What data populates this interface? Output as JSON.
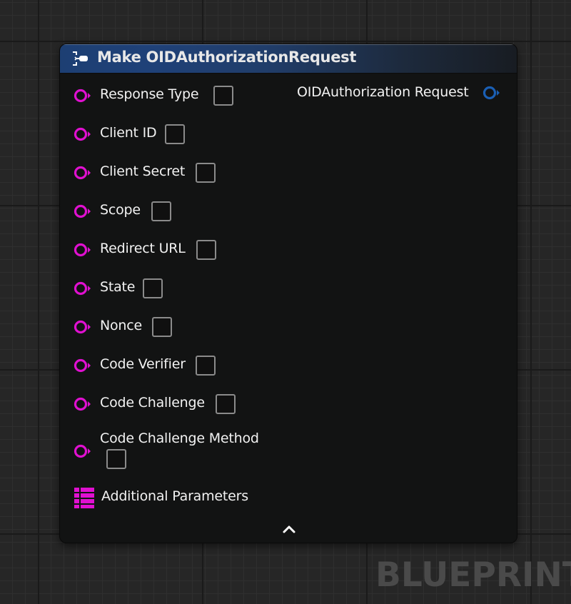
{
  "node": {
    "title": "Make OIDAuthorizationRequest",
    "icon": "make-struct-icon",
    "header_color": "#1f4178",
    "output_pin": {
      "label": "OIDAuthorization Request",
      "icon": "struct-pin-icon",
      "color": "#1a5fb4"
    },
    "input_pins": [
      {
        "label": "Response Type",
        "icon": "string-pin-icon"
      },
      {
        "label": "Client ID",
        "icon": "string-pin-icon"
      },
      {
        "label": "Client Secret",
        "icon": "string-pin-icon"
      },
      {
        "label": "Scope",
        "icon": "string-pin-icon"
      },
      {
        "label": "Redirect URL",
        "icon": "string-pin-icon"
      },
      {
        "label": "State",
        "icon": "string-pin-icon"
      },
      {
        "label": "Nonce",
        "icon": "string-pin-icon"
      },
      {
        "label": "Code Verifier",
        "icon": "string-pin-icon"
      },
      {
        "label": "Code Challenge",
        "icon": "string-pin-icon"
      },
      {
        "label": "Code Challenge Method",
        "icon": "string-pin-icon"
      }
    ],
    "map_pin": {
      "label": "Additional Parameters",
      "icon": "map-pin-icon"
    },
    "pin_color": "#e010d0",
    "collapse_icon": "chevron-up-icon"
  },
  "watermark": "BLUEPRINT"
}
